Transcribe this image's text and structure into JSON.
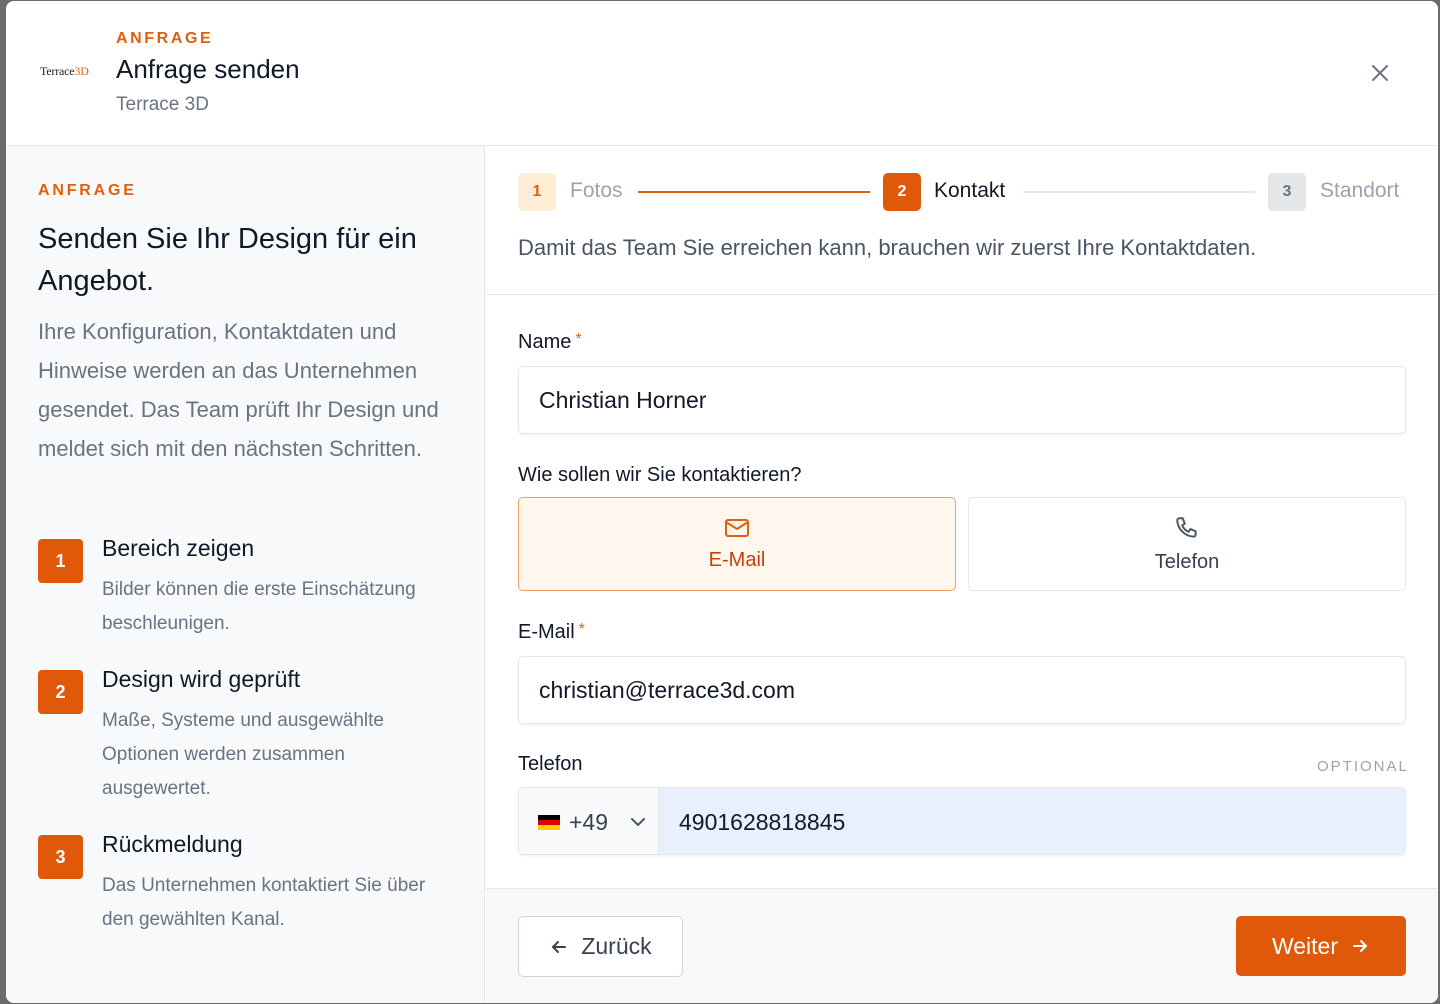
{
  "header": {
    "logo_text_main": "Terrace",
    "logo_text_accent": "3D",
    "eyebrow": "ANFRAGE",
    "title": "Anfrage senden",
    "subtitle": "Terrace 3D"
  },
  "sidebar": {
    "eyebrow": "ANFRAGE",
    "headline": "Senden Sie Ihr Design für ein Angebot.",
    "description": "Ihre Konfiguration, Kontaktdaten und Hinweise werden an das Unternehmen gesendet. Das Team prüft Ihr Design und meldet sich mit den nächsten Schritten.",
    "steps": [
      {
        "number": "1",
        "title": "Bereich zeigen",
        "description": "Bilder können die erste Einschätzung beschleunigen."
      },
      {
        "number": "2",
        "title": "Design wird geprüft",
        "description": "Maße, Systeme und ausgewählte Optionen werden zusammen ausgewertet."
      },
      {
        "number": "3",
        "title": "Rückmeldung",
        "description": "Das Unternehmen kontaktiert Sie über den gewählten Kanal."
      }
    ]
  },
  "stepper": {
    "steps": [
      {
        "number": "1",
        "label": "Fotos",
        "state": "completed"
      },
      {
        "number": "2",
        "label": "Kontakt",
        "state": "active"
      },
      {
        "number": "3",
        "label": "Standort",
        "state": "upcoming"
      }
    ]
  },
  "form": {
    "intro": "Damit das Team Sie erreichen kann, brauchen wir zuerst Ihre Kontaktdaten.",
    "name_label": "Name",
    "name_value": "Christian Horner",
    "required_marker": "*",
    "contact_question": "Wie sollen wir Sie kontaktieren?",
    "contact_options": [
      {
        "label": "E-Mail",
        "icon": "mail-icon",
        "selected": true
      },
      {
        "label": "Telefon",
        "icon": "phone-icon",
        "selected": false
      }
    ],
    "email_label": "E-Mail",
    "email_value": "christian@terrace3d.com",
    "phone_label": "Telefon",
    "phone_optional": "OPTIONAL",
    "country_code": "+49",
    "country_flag": "flag-de-icon",
    "phone_value": "4901628818845"
  },
  "footer": {
    "back_label": "Zurück",
    "next_label": "Weiter"
  },
  "colors": {
    "accent": "#e0580a",
    "accent_light": "#fff7ed",
    "muted_text": "#6b7280"
  }
}
